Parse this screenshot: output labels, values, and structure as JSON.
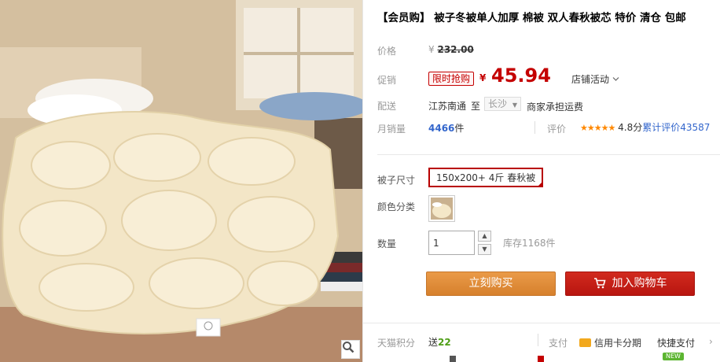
{
  "product": {
    "title": "【会员购】 被子冬被单人加厚 棉被 双人春秋被芯 特价 清仓 包邮"
  },
  "price": {
    "label": "价格",
    "currency": "¥",
    "original": "232.00"
  },
  "promotion": {
    "label": "促销",
    "badge": "限时抢购",
    "currency": "¥",
    "price": "45.94",
    "shop_activity": "店铺活动"
  },
  "shipping": {
    "label": "配送",
    "from": "江苏南通",
    "to_word": "至",
    "city": "长沙",
    "fee_text": "商家承担运费"
  },
  "sales": {
    "label": "月销量",
    "count": "4466",
    "unit": "件",
    "review_label": "评价",
    "rating_text": "4.8分",
    "review_text": "累计评价",
    "review_count": "43587",
    "stars": 4.8
  },
  "options": {
    "size_label": "被子尺寸",
    "size_value": "150x200+ 4斤 春秋被",
    "color_label": "颜色分类",
    "qty_label": "数量",
    "qty_value": "1",
    "stock_text": "库存1168件"
  },
  "actions": {
    "buy_now": "立刻购买",
    "add_to_cart": "加入购物车"
  },
  "bottom": {
    "points_label": "天猫积分",
    "points_prefix": "送",
    "points_value": "22",
    "pay_label": "支付",
    "credit_label": "信用卡分期",
    "quickpay_label": "快捷支付",
    "new_badge": "NEW"
  },
  "colors": {
    "accent_red": "#c40000",
    "buy_orange": "#e58e36",
    "cart_red": "#c11c14",
    "link_blue": "#3366cc",
    "points_green": "#4e9e16"
  }
}
